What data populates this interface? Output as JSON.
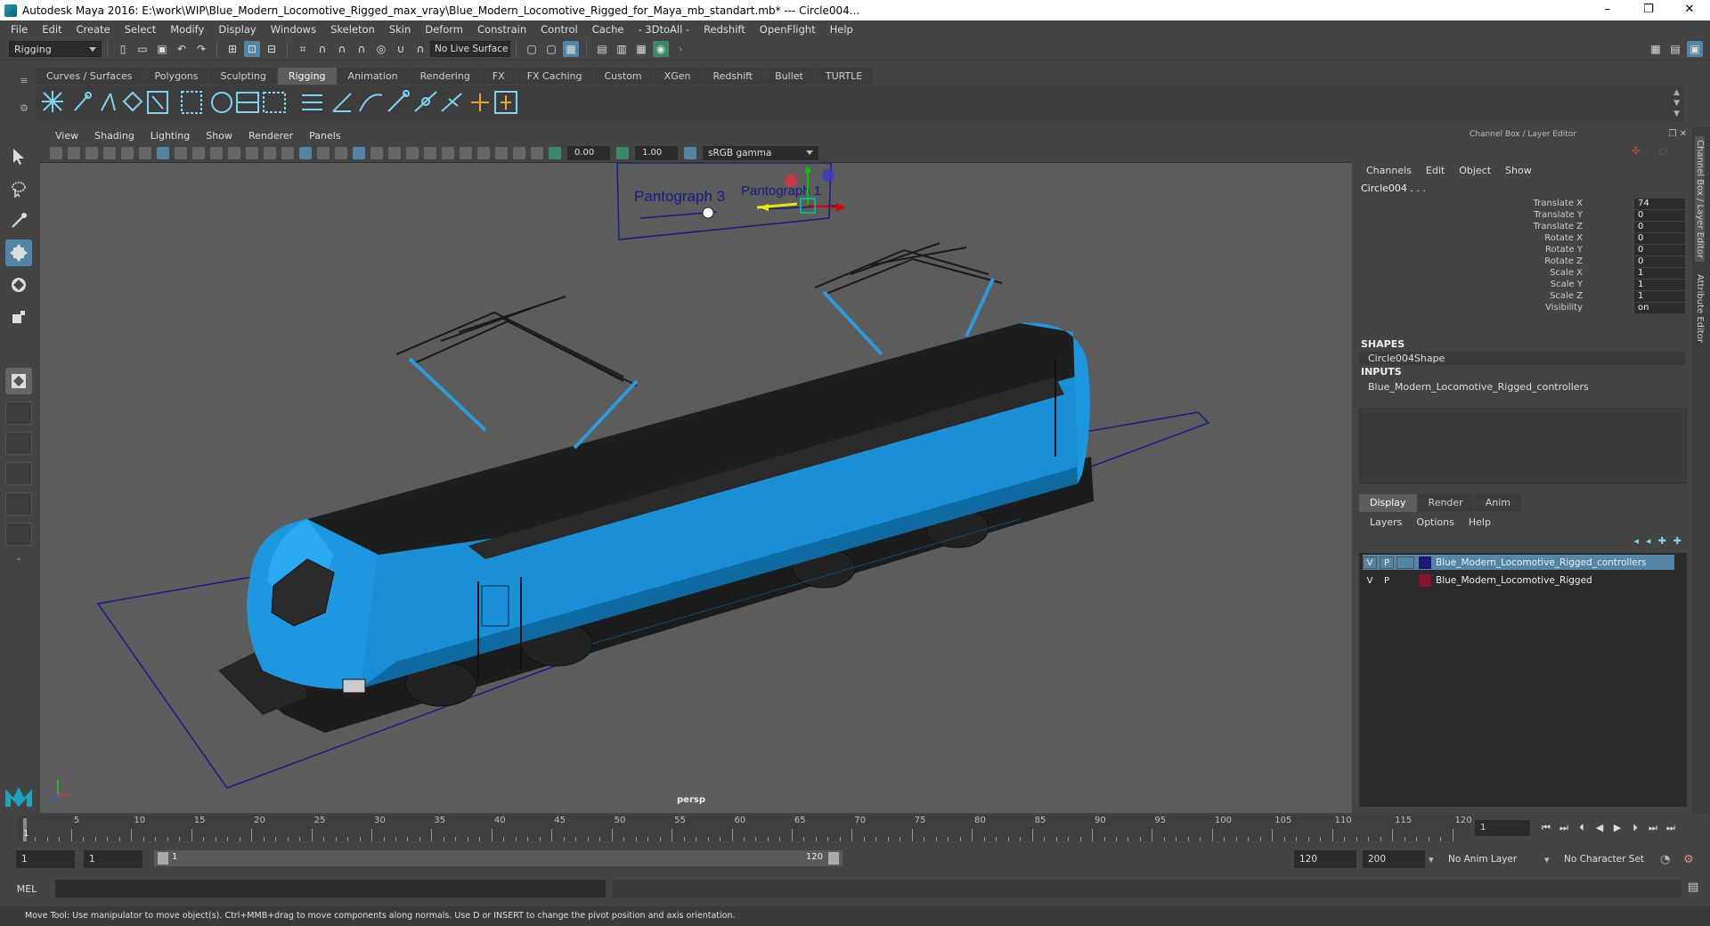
{
  "window": {
    "title": "Autodesk Maya 2016: E:\\work\\WIP\\Blue_Modern_Locomotive_Rigged_max_vray\\Blue_Modern_Locomotive_Rigged_for_Maya_mb_standart.mb*  ---  Circle004...",
    "minimize": "–",
    "maximize": "❐",
    "close": "✕"
  },
  "menubar": [
    "File",
    "Edit",
    "Create",
    "Select",
    "Modify",
    "Display",
    "Windows",
    "Skeleton",
    "Skin",
    "Deform",
    "Constrain",
    "Control",
    "Cache",
    "- 3DtoAll -",
    "Redshift",
    "OpenFlight",
    "Help"
  ],
  "statusline": {
    "mode": "Rigging",
    "live_surface": "No Live Surface"
  },
  "shelf_tabs": [
    "Curves / Surfaces",
    "Polygons",
    "Sculpting",
    "Rigging",
    "Animation",
    "Rendering",
    "FX",
    "FX Caching",
    "Custom",
    "XGen",
    "Redshift",
    "Bullet",
    "TURTLE"
  ],
  "shelf_active": "Rigging",
  "viewport": {
    "menu": [
      "View",
      "Shading",
      "Lighting",
      "Show",
      "Renderer",
      "Panels"
    ],
    "exposure": "0.00",
    "gamma": "1.00",
    "color_space": "sRGB gamma",
    "camera": "persp",
    "labels": [
      "Pantograph 3",
      "Pantograph 1"
    ]
  },
  "channel_box": {
    "title": "Channel Box / Layer Editor",
    "menu": [
      "Channels",
      "Edit",
      "Object",
      "Show"
    ],
    "node": "Circle004 . . .",
    "attributes": [
      {
        "label": "Translate X",
        "value": "74"
      },
      {
        "label": "Translate Y",
        "value": "0"
      },
      {
        "label": "Translate Z",
        "value": "0"
      },
      {
        "label": "Rotate X",
        "value": "0"
      },
      {
        "label": "Rotate Y",
        "value": "0"
      },
      {
        "label": "Rotate Z",
        "value": "0"
      },
      {
        "label": "Scale X",
        "value": "1"
      },
      {
        "label": "Scale Y",
        "value": "1"
      },
      {
        "label": "Scale Z",
        "value": "1"
      },
      {
        "label": "Visibility",
        "value": "on"
      }
    ],
    "shapes_head": "SHAPES",
    "shapes_item": "Circle004Shape",
    "inputs_head": "INPUTS",
    "inputs_item": "Blue_Modern_Locomotive_Rigged_controllers"
  },
  "layer_editor": {
    "tabs": [
      "Display",
      "Render",
      "Anim"
    ],
    "menu": [
      "Layers",
      "Options",
      "Help"
    ],
    "layers": [
      {
        "v": "V",
        "p": "P",
        "name": "Blue_Modern_Locomotive_Rigged_controllers",
        "color": "#1a1a7a"
      },
      {
        "v": "V",
        "p": "P",
        "name": "Blue_Modern_Locomotive_Rigged",
        "color": "#8a1030"
      }
    ]
  },
  "side_tabs": [
    "Channel Box / Layer Editor",
    "Attribute Editor"
  ],
  "time_slider": {
    "labels": [
      "5",
      "10",
      "15",
      "20",
      "25",
      "30",
      "35",
      "40",
      "45",
      "50",
      "55",
      "60",
      "65",
      "70",
      "75",
      "80",
      "85",
      "90",
      "95",
      "100",
      "105",
      "110",
      "115",
      "120"
    ],
    "current": "1"
  },
  "playback": {
    "current_frame": "1",
    "buttons": [
      "⏮",
      "⏭",
      "⏴",
      "◀",
      "▶",
      "⏵",
      "⏭",
      "⏭"
    ]
  },
  "range": {
    "start": "1",
    "playback_start": "1",
    "slider_start": "1",
    "slider_end": "120",
    "playback_end": "120",
    "end": "200",
    "anim_layer": "No Anim Layer",
    "character_set": "No Character Set"
  },
  "cmdline": {
    "label": "MEL"
  },
  "help_text": "Move Tool: Use manipulator to move object(s). Ctrl+MMB+drag to move components along normals. Use D or INSERT to change the pivot position and axis orientation.",
  "colors": {
    "accent": "#5285a6",
    "locomotive": "#1a8fd6",
    "shelf_icon": "#7dd3f0",
    "ground": "#1a1a8a"
  }
}
